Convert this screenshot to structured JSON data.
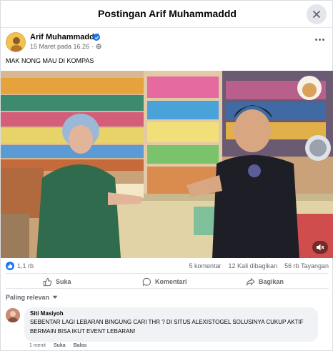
{
  "header": {
    "title": "Postingan Arif Muhammaddd"
  },
  "post": {
    "author": "Arif Muhammaddd",
    "timestamp": "15 Maret pada 16.26",
    "privacy_icon": "globe-icon",
    "text": "MAK NONG MAU DI KOMPAS"
  },
  "stats": {
    "reactions": "1,1 rb",
    "comments": "5 komentar",
    "shares": "12 Kali dibagikan",
    "views": "56 rb Tayangan"
  },
  "actions": {
    "like": "Suka",
    "comment": "Komentari",
    "share": "Bagikan"
  },
  "comments_section": {
    "sort_label": "Paling relevan",
    "items": [
      {
        "author": "Siti Masiyoh",
        "text": "SEBENTAR LAGI LEBARAN BINGUNG CARI THR ? DI SITUS ALEXISTOGEL SOLUSINYA CUKUP AKTIF BERMAIN BISA IKUT EVENT LEBARAN!",
        "time": "1 menit",
        "like": "Suka",
        "reply": "Balas"
      }
    ]
  },
  "colors": {
    "accent": "#1877f2",
    "secondary_text": "#65676b",
    "bubble": "#f0f2f5"
  }
}
